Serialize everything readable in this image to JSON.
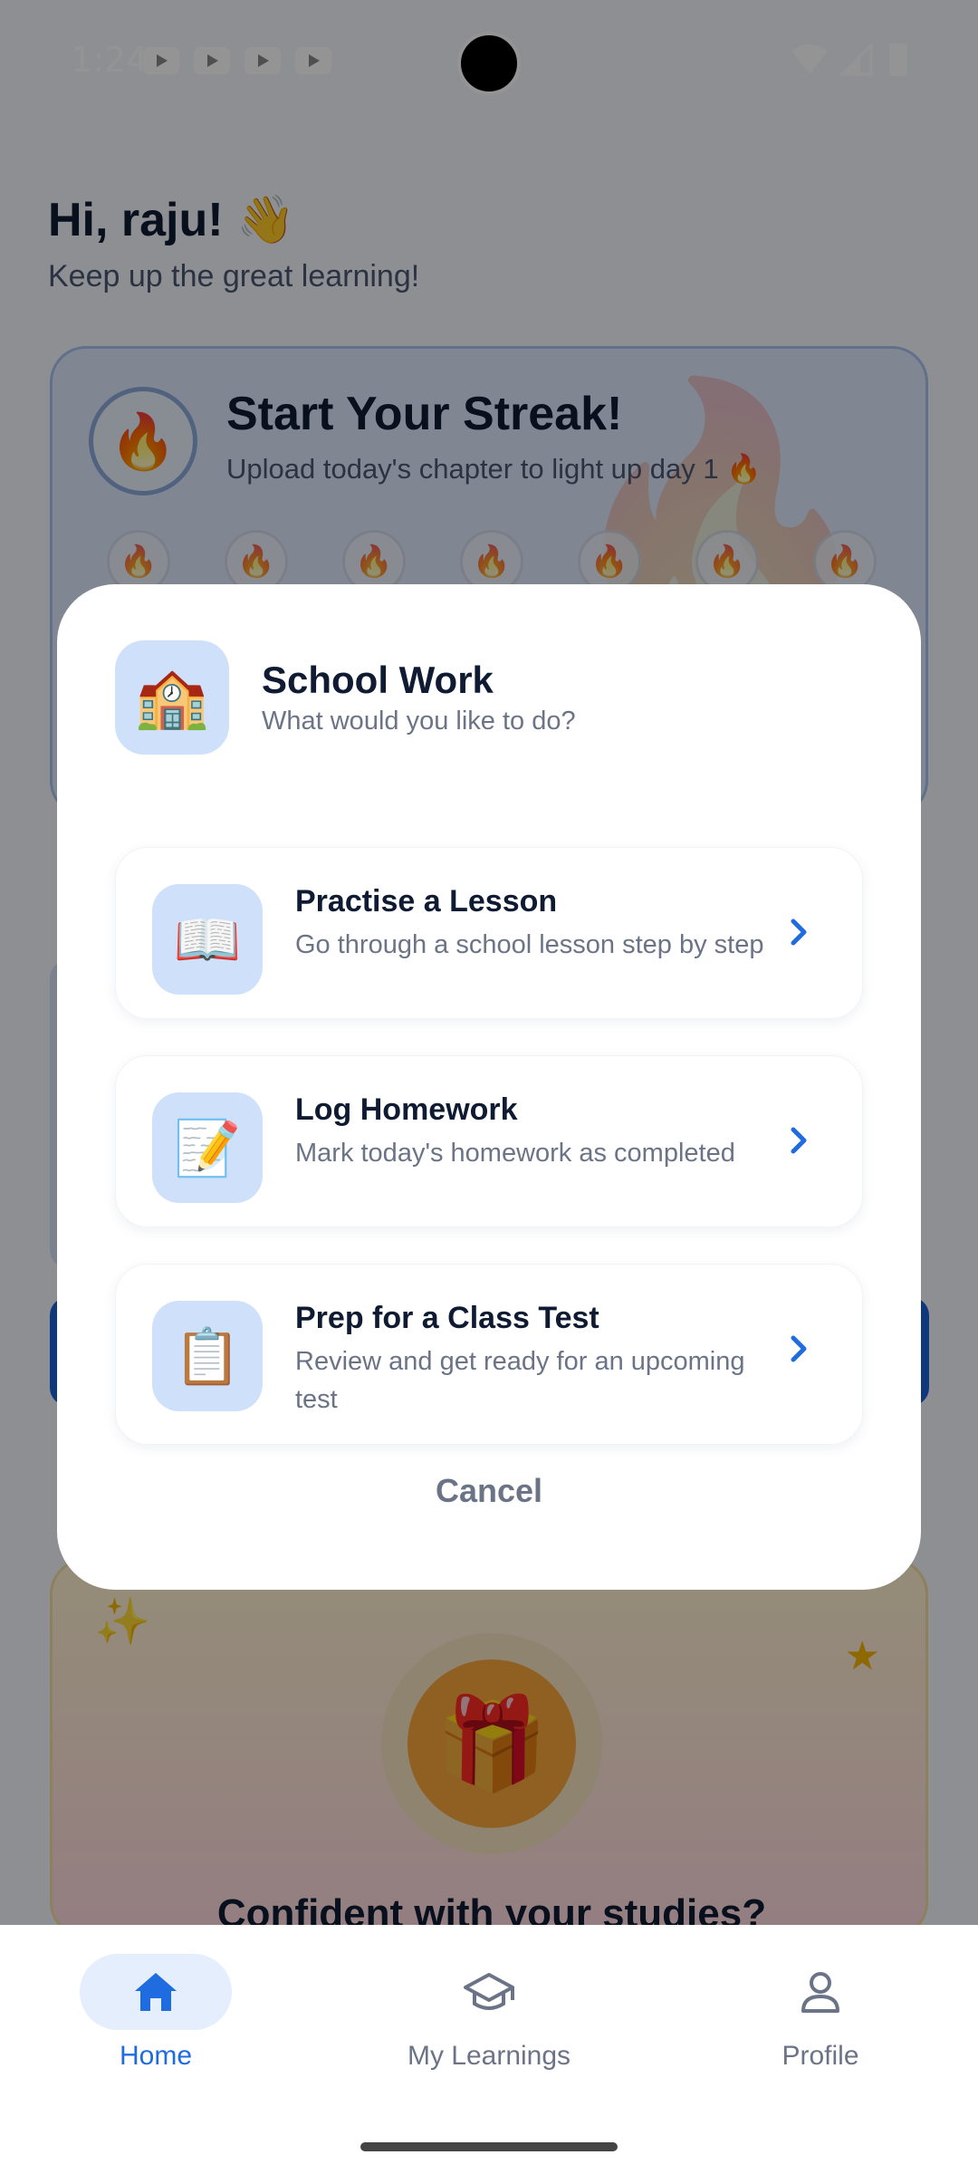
{
  "status_bar": {
    "time": "1:24"
  },
  "home": {
    "greeting": "Hi, raju! 👋",
    "greeting_sub": "Keep up the great learning!",
    "streak": {
      "icon": "🔥",
      "title": "Start Your Streak!",
      "subtitle": "Upload today's chapter to light up day 1 🔥",
      "day_icon": "🔥"
    },
    "promo": {
      "sparkle": "✨",
      "star": "★",
      "gift": "🎁",
      "title": "Confident with your studies?"
    }
  },
  "modal": {
    "icon": "🏫",
    "title": "School Work",
    "subtitle": "What would you like to do?",
    "options": [
      {
        "icon": "📖",
        "title": "Practise a Lesson",
        "subtitle": "Go through a school lesson step by step"
      },
      {
        "icon": "📝",
        "title": "Log Homework",
        "subtitle": "Mark today's homework as completed"
      },
      {
        "icon": "📋",
        "title": "Prep for a Class Test",
        "subtitle": "Review and get ready for an upcoming test"
      }
    ],
    "cancel_label": "Cancel"
  },
  "bottom_nav": {
    "items": [
      {
        "label": "Home",
        "icon": "home-icon",
        "active": true
      },
      {
        "label": "My Learnings",
        "icon": "graduation-cap-icon",
        "active": false
      },
      {
        "label": "Profile",
        "icon": "person-icon",
        "active": false
      }
    ]
  },
  "colors": {
    "accent": "#1f6ce0",
    "icon_tile": "#cfe0fb",
    "text_primary": "#0f1b33",
    "text_secondary": "#6b7487"
  }
}
